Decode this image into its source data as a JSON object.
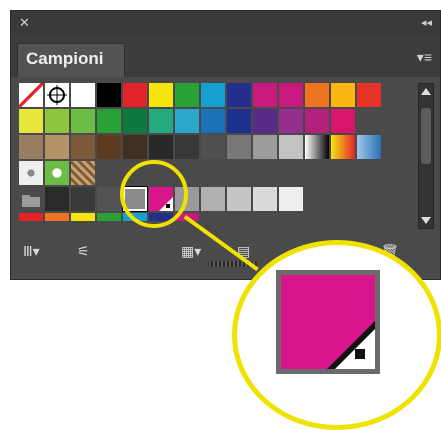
{
  "panel": {
    "title_icons": {
      "close": "close-icon",
      "collapse": "double-chevron-left-icon"
    },
    "tab_label": "Campioni",
    "menu_icon": "panel-menu-icon"
  },
  "swatches": {
    "row1": [
      "#ffffff",
      "#000000",
      "#e2232a",
      "#f5e50e",
      "#2aa137",
      "#14a1d2",
      "#232e8d",
      "#c8197e",
      "#c8197e",
      "#ef7421",
      "#fbb612",
      "#e6332a"
    ],
    "row2": [
      "#e8e63d",
      "#8dc63f",
      "#6cbd45",
      "#2aa137",
      "#0c7a3e",
      "#25aa7f",
      "#2aa7c9",
      "#1a73b8",
      "#1d2f8f",
      "#5a2b86",
      "#962f8c",
      "#b0227b",
      "#d8156c"
    ],
    "row3": [
      "#9a7e60",
      "#b49466",
      "#7c5a3a",
      "#5b3c21",
      "#403022",
      "#292929",
      "#383838",
      "#505050",
      "#787878",
      "#9b9b9b",
      "#c3c3c3"
    ],
    "row5": [
      "#2a2a2a",
      "#3a3a3a",
      "#535353",
      "#8b8b8b",
      "#d8158a",
      "#9a9a9a",
      "#b0b0b0",
      "#c5c5c5",
      "#dadada",
      "#eeeeee"
    ],
    "row6": [
      "#e2232a",
      "#ef7421",
      "#f5e50e",
      "#2aa137",
      "#14a1d2",
      "#232e8d",
      "#c8197e"
    ]
  },
  "highlight": {
    "color": "#f0e200",
    "zoom_swatch_color": "#d8158a"
  },
  "toolbar": {
    "library_icon": "swatch-library-icon",
    "show_kinds_icon": "show-kinds-icon",
    "group_icon": "new-color-group-icon",
    "options_icon": "swatch-options-icon",
    "delete_icon": "delete-swatch-icon"
  }
}
